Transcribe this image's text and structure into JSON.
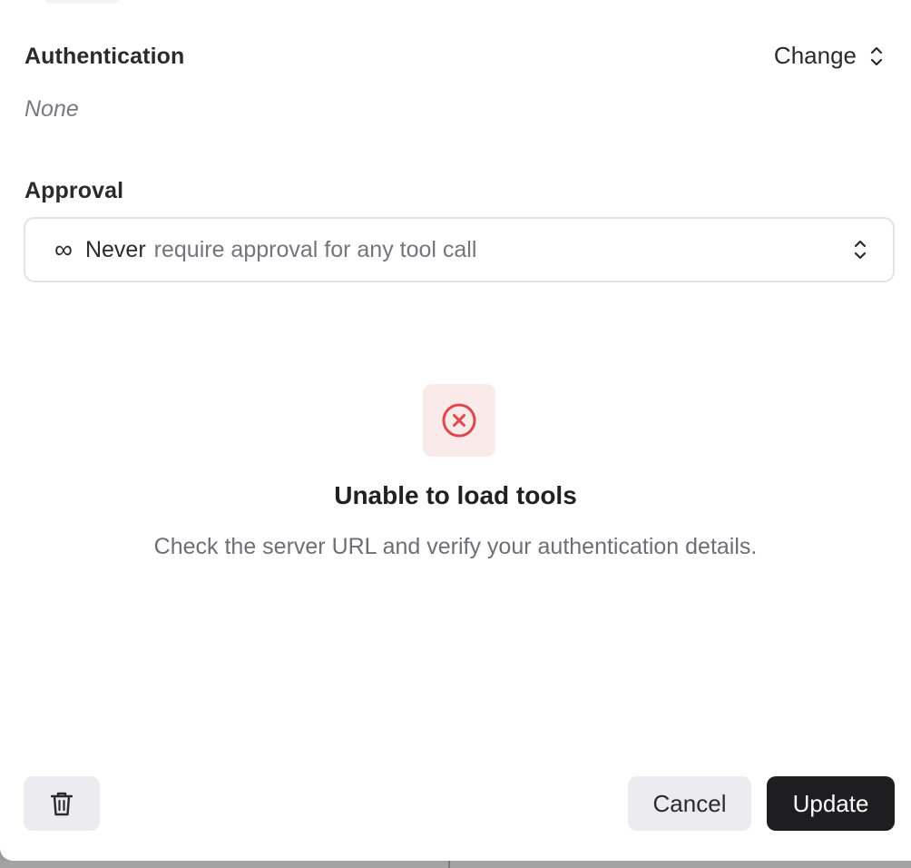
{
  "authentication": {
    "title": "Authentication",
    "change_label": "Change",
    "value": "None"
  },
  "approval": {
    "title": "Approval",
    "selected_value": "Never",
    "selected_description": "require approval for any tool call",
    "icon": "infinity-icon"
  },
  "error": {
    "icon": "x-circle-icon",
    "title": "Unable to load tools",
    "description": "Check the server URL and verify your authentication details."
  },
  "footer": {
    "delete_icon": "trash-icon",
    "cancel_label": "Cancel",
    "update_label": "Update"
  },
  "colors": {
    "error_red": "#e0474c",
    "error_bg": "#fbeaea",
    "primary_button": "#1e1e20",
    "secondary_button": "#ececf0"
  }
}
